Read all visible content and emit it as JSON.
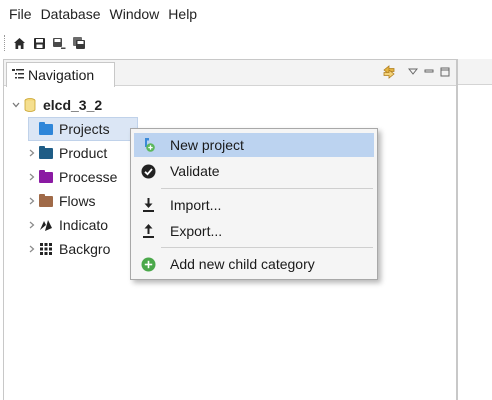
{
  "menu": [
    "File",
    "Database",
    "Window",
    "Help"
  ],
  "toolbar": {
    "icons": [
      "home-icon",
      "save-icon",
      "save-as-icon",
      "save-all-icon"
    ]
  },
  "navigation": {
    "tab_label": "Navigation",
    "header_buttons": [
      "link-with-editor-icon",
      "view-menu-icon",
      "minimize-icon",
      "maximize-icon"
    ]
  },
  "tree": {
    "root": {
      "label": "elcd_3_2",
      "icon": "database-icon",
      "expanded": true
    },
    "items": [
      {
        "label": "Projects",
        "icon": "folder-icon",
        "color": "#2e86d9",
        "selected": true,
        "expandable": false
      },
      {
        "label": "Product",
        "icon": "folder-icon",
        "color": "#1f5d86",
        "expandable": true
      },
      {
        "label": "Processe",
        "icon": "folder-icon",
        "color": "#8b1aa3",
        "expandable": true
      },
      {
        "label": "Flows",
        "icon": "folder-icon",
        "color": "#a06a48",
        "expandable": true
      },
      {
        "label": "Indicato",
        "icon": "indicator-icon",
        "color": "#222222",
        "expandable": true
      },
      {
        "label": "Backgro",
        "icon": "grid-icon",
        "color": "#222222",
        "expandable": true
      }
    ]
  },
  "context_menu": {
    "items": [
      {
        "label": "New project",
        "icon": "new-project-icon",
        "highlighted": true
      },
      {
        "label": "Validate",
        "icon": "check-circle-icon"
      },
      {
        "label": "Import...",
        "icon": "import-icon"
      },
      {
        "label": "Export...",
        "icon": "export-icon"
      },
      {
        "label": "Add new child category",
        "icon": "add-circle-icon"
      }
    ]
  },
  "colors": {
    "selection": "#dbe6f5",
    "menu_highlight": "#bcd3f0",
    "database_icon": "#e8c44a"
  }
}
